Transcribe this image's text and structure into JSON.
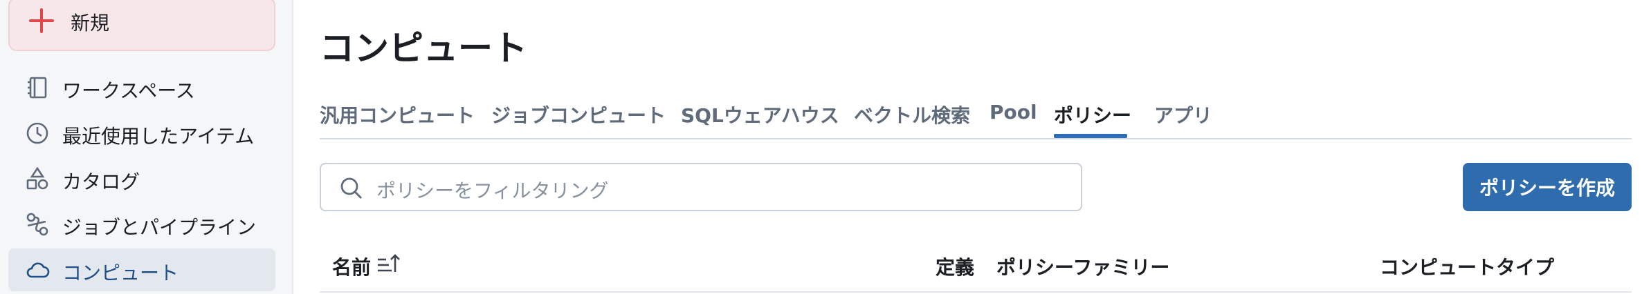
{
  "sidebar": {
    "new_label": "新規",
    "items": [
      {
        "label": "ワークスペース",
        "icon": "notebook-icon"
      },
      {
        "label": "最近使用したアイテム",
        "icon": "clock-icon"
      },
      {
        "label": "カタログ",
        "icon": "catalog-shapes-icon"
      },
      {
        "label": "ジョブとパイプライン",
        "icon": "workflows-icon"
      },
      {
        "label": "コンピュート",
        "icon": "cloud-icon",
        "active": true
      }
    ]
  },
  "main": {
    "title": "コンピュート",
    "tabs": [
      {
        "label": "汎用コンピュート"
      },
      {
        "label": "ジョブコンピュート"
      },
      {
        "label": "SQLウェアハウス"
      },
      {
        "label": "ベクトル検索"
      },
      {
        "label": "Pool"
      },
      {
        "label": "ポリシー",
        "active": true
      },
      {
        "label": "アプリ"
      }
    ],
    "search": {
      "placeholder": "ポリシーをフィルタリング"
    },
    "create_label": "ポリシーを作成",
    "table": {
      "columns": [
        "名前",
        "定義",
        "ポリシーファミリー",
        "コンピュートタイプ"
      ]
    }
  },
  "colors": {
    "accent": "#2f6cad",
    "active_tab_underline": "#2e6eb8",
    "new_button_bg": "#f7e7e8",
    "plus_icon": "#e04848"
  }
}
